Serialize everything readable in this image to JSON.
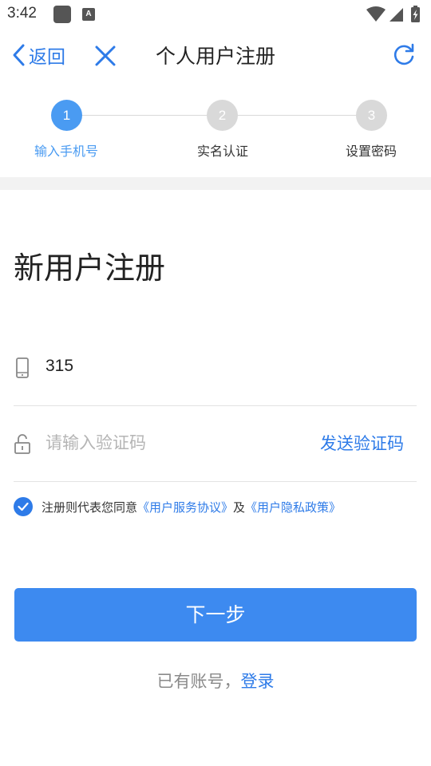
{
  "status_bar": {
    "time": "3:42",
    "app_badge_letter": "A"
  },
  "nav": {
    "back_label": "返回",
    "title": "个人用户注册"
  },
  "steps": [
    {
      "number": "1",
      "label": "输入手机号",
      "state": "active"
    },
    {
      "number": "2",
      "label": "实名认证",
      "state": "inactive"
    },
    {
      "number": "3",
      "label": "设置密码",
      "state": "inactive"
    }
  ],
  "form": {
    "title": "新用户注册",
    "phone_value": "315",
    "code_placeholder": "请输入验证码",
    "send_code_label": "发送验证码"
  },
  "agreement": {
    "checked": true,
    "prefix": "注册则代表您同意",
    "service_link": "《用户服务协议》",
    "connector": "及",
    "privacy_link": "《用户隐私政策》"
  },
  "next_button": "下一步",
  "login": {
    "prompt": "已有账号，",
    "link": "登录"
  },
  "colors": {
    "accent": "#2e7be8",
    "button": "#3d8af0",
    "step_active": "#4a9bf2",
    "step_inactive": "#d9d9d9",
    "band": "#f2f2f2"
  }
}
